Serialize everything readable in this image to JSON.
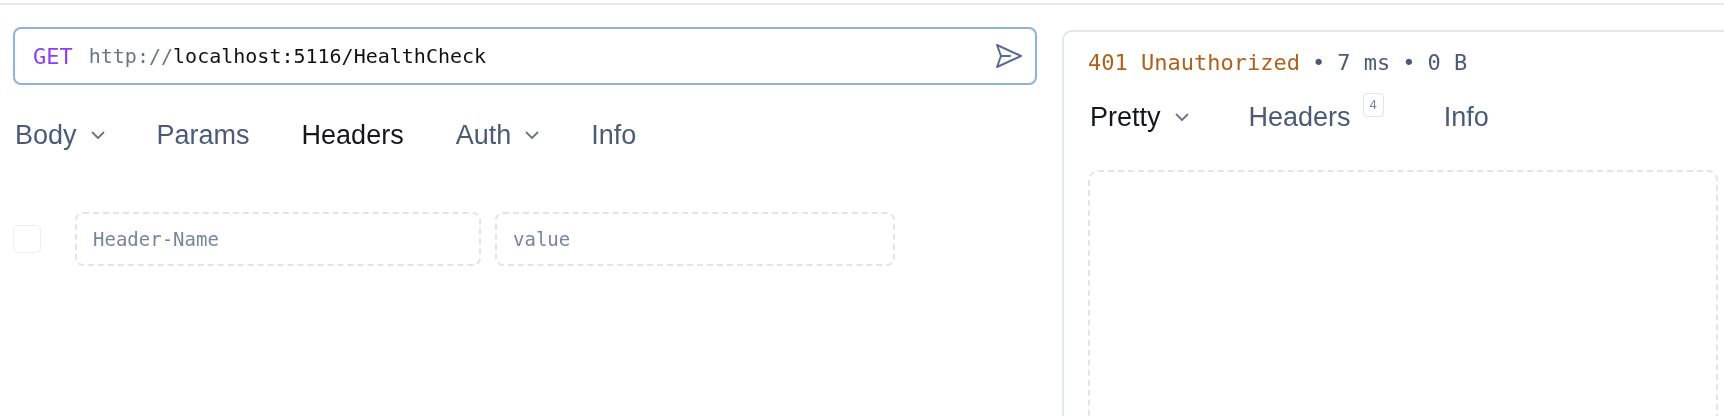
{
  "request": {
    "method": "GET",
    "url": {
      "scheme": "http://",
      "rest": "localhost:5116/HealthCheck"
    },
    "tabs": [
      {
        "label": "Body",
        "selected": false,
        "dropdown": true
      },
      {
        "label": "Params",
        "selected": false,
        "dropdown": false
      },
      {
        "label": "Headers",
        "selected": true,
        "dropdown": false
      },
      {
        "label": "Auth",
        "selected": false,
        "dropdown": true
      },
      {
        "label": "Info",
        "selected": false,
        "dropdown": false
      }
    ],
    "header_rows": [
      {
        "checked": false,
        "name_placeholder": "Header-Name",
        "value_placeholder": "value"
      }
    ]
  },
  "response": {
    "status": "401 Unauthorized",
    "separator": "•",
    "time": "7 ms",
    "size": "0 B",
    "tabs": [
      {
        "label": "Pretty",
        "selected": true,
        "dropdown": true
      },
      {
        "label": "Headers",
        "selected": false,
        "dropdown": false,
        "count": "4"
      },
      {
        "label": "Info",
        "selected": false,
        "dropdown": false
      }
    ]
  }
}
